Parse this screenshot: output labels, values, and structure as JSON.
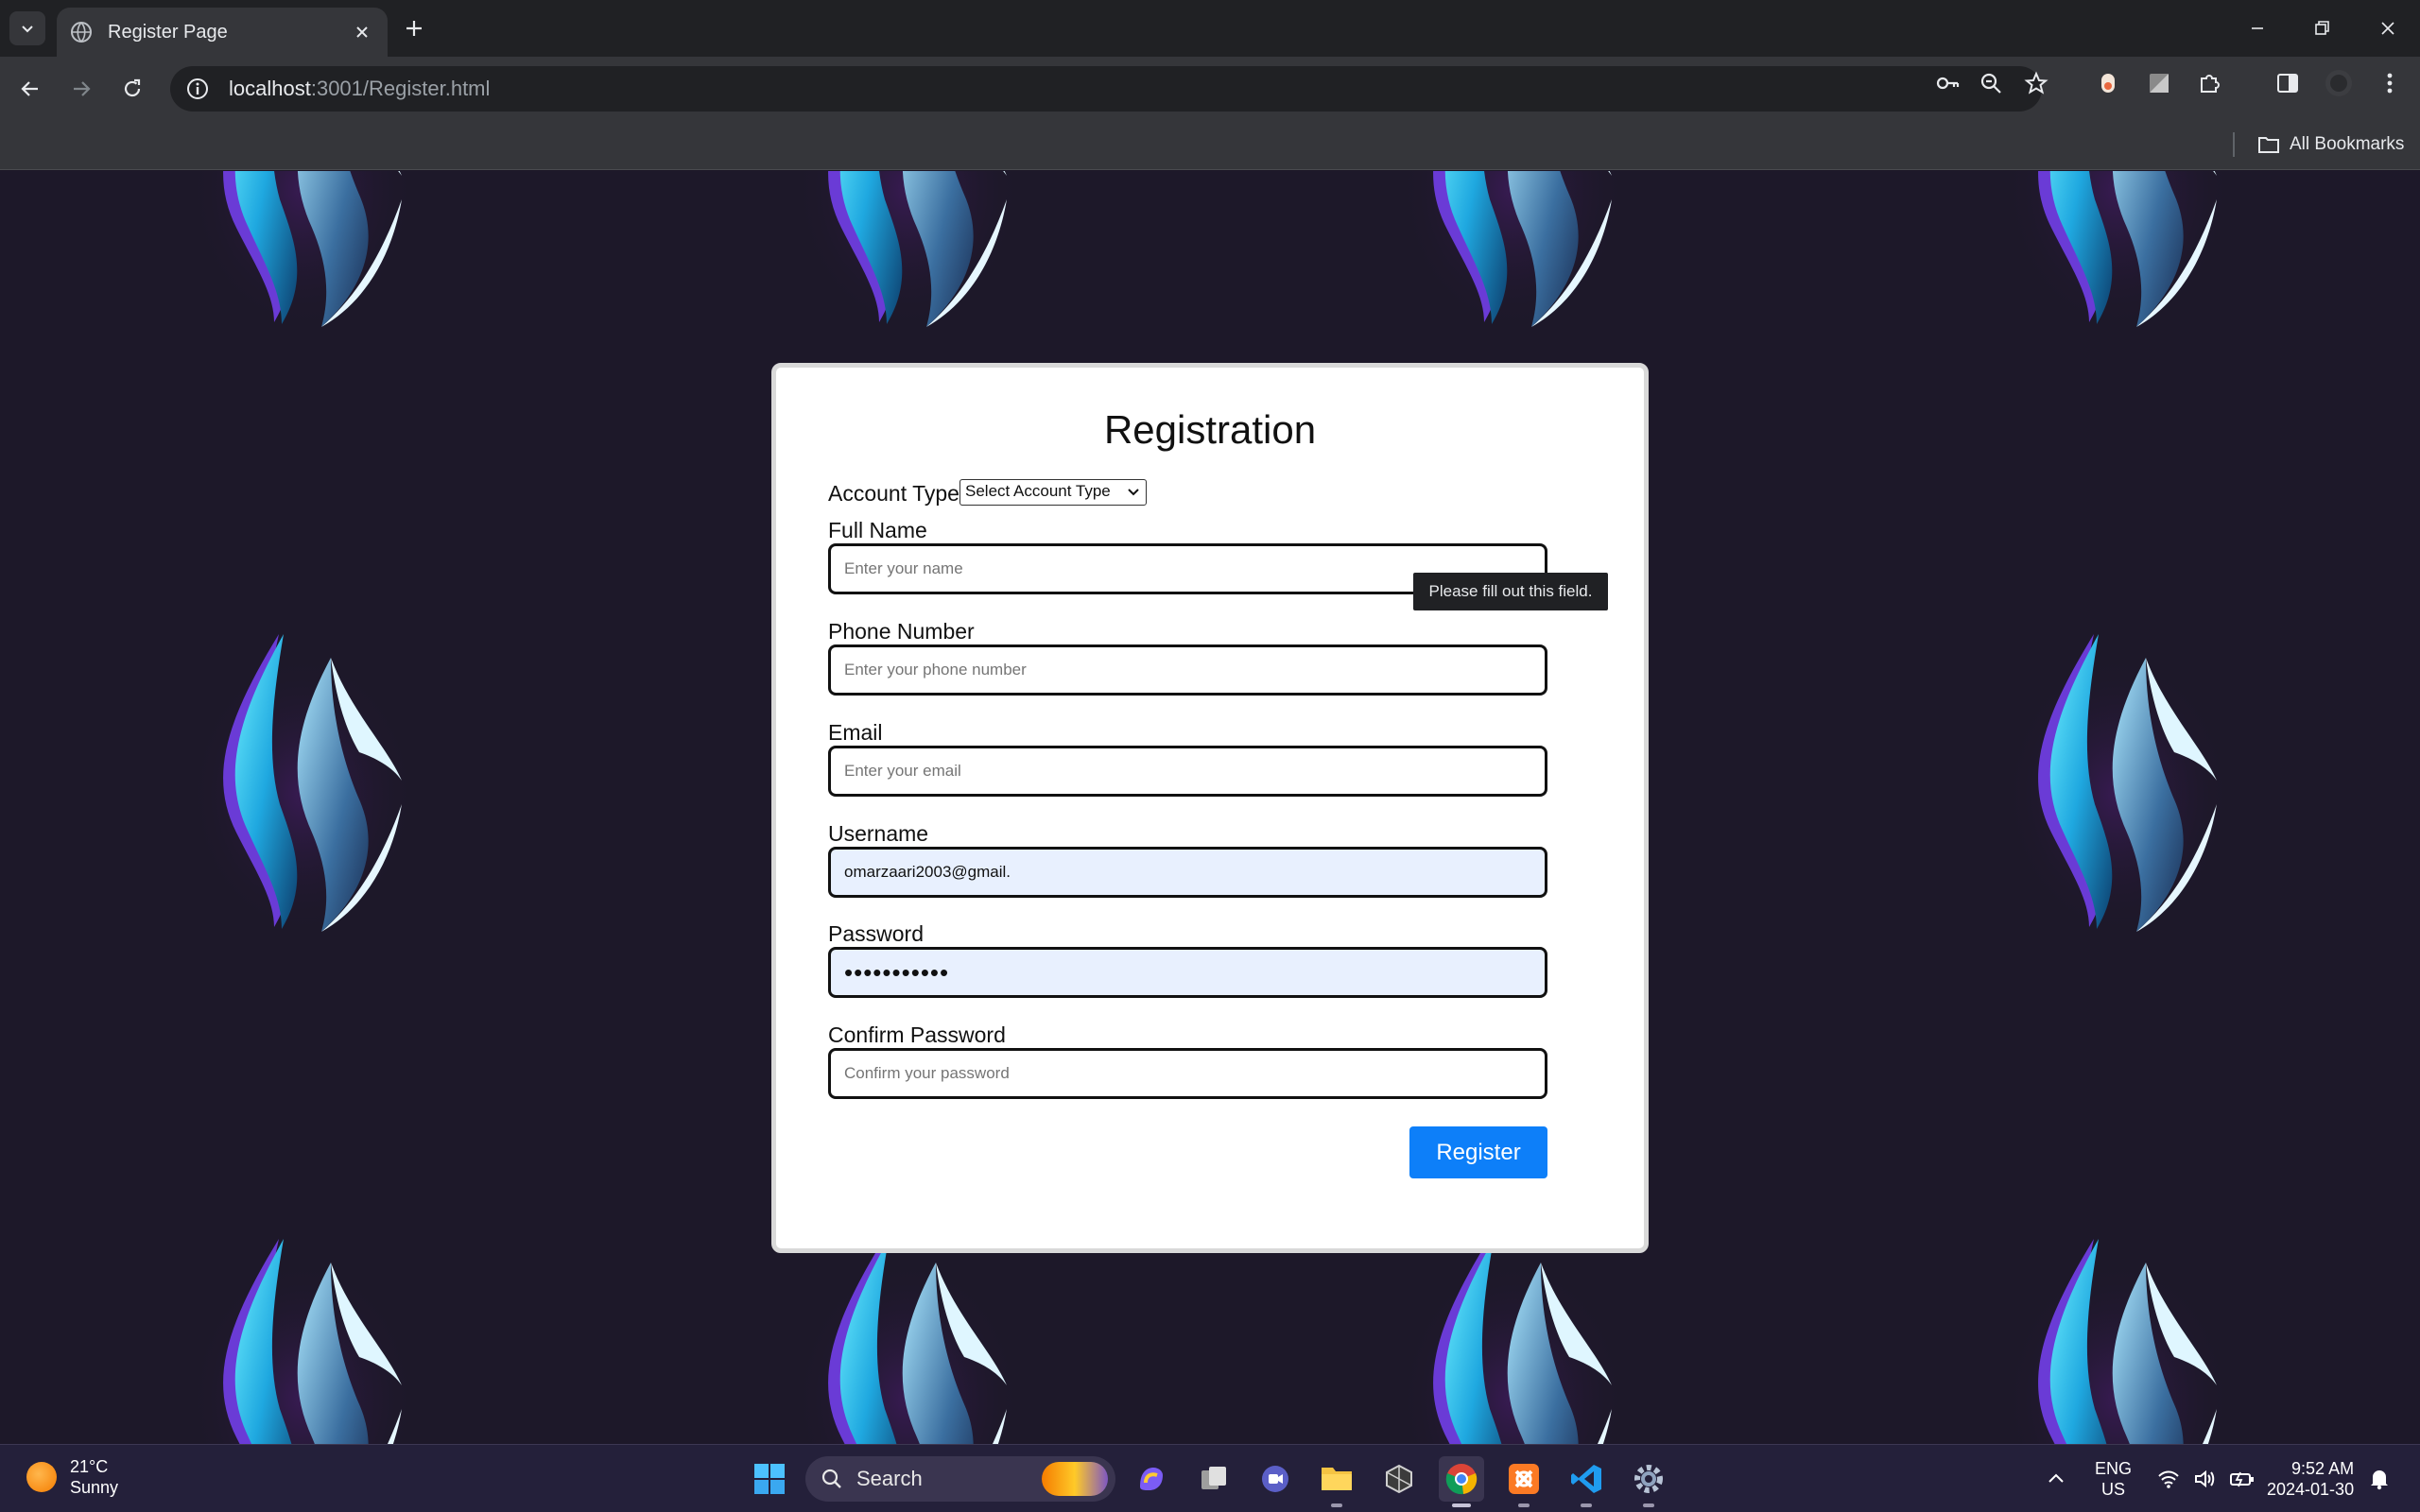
{
  "browser": {
    "tab_title": "Register Page",
    "url_host": "localhost",
    "url_path": ":3001/Register.html",
    "all_bookmarks": "All Bookmarks"
  },
  "form": {
    "title": "Registration",
    "account_type_label": "Account Type",
    "account_type_selected": "Select Account Type",
    "full_name_label": "Full Name",
    "full_name_placeholder": "Enter your name",
    "tooltip": "Please fill out this field.",
    "phone_label": "Phone Number",
    "phone_placeholder": "Enter your phone number",
    "email_label": "Email",
    "email_placeholder": "Enter your email",
    "username_label": "Username",
    "username_value": "omarzaari2003@gmail.",
    "password_label": "Password",
    "password_value": "•••••••••••",
    "confirm_label": "Confirm Password",
    "confirm_placeholder": "Confirm your password",
    "register_label": "Register"
  },
  "taskbar": {
    "temperature": "21°C",
    "weather": "Sunny",
    "search_label": "Search",
    "lang_line1": "ENG",
    "lang_line2": "US",
    "time": "9:52 AM",
    "date": "2024-01-30"
  },
  "colors": {
    "accent": "#0d7ff9",
    "page_bg": "#1d1829",
    "autofill_bg": "#e8f0fe"
  }
}
